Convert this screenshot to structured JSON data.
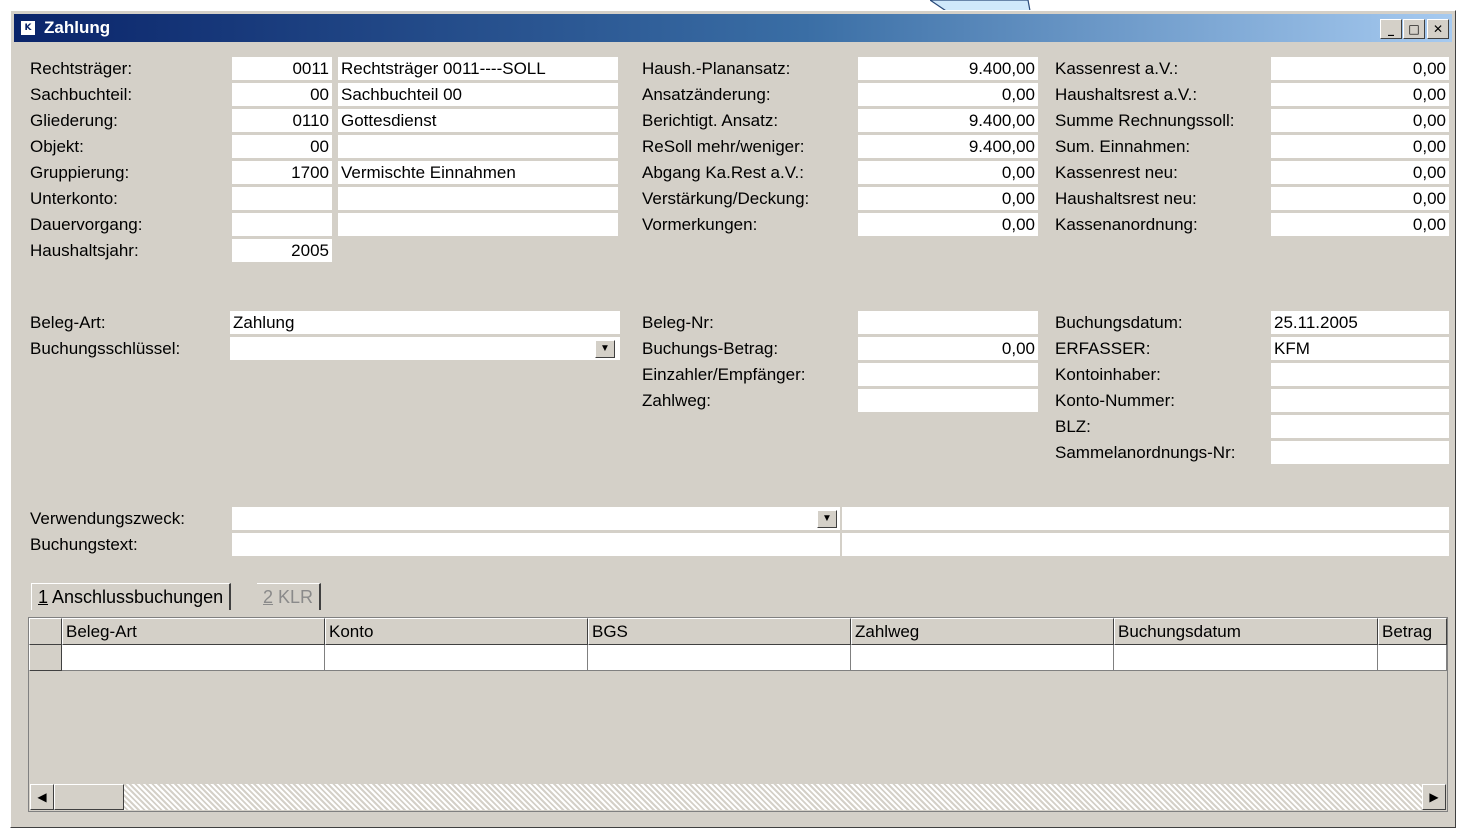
{
  "window": {
    "title": "Zahlung",
    "icon": "app-icon"
  },
  "left": [
    {
      "label": "Rechtsträger:",
      "code": "0011",
      "text": "Rechtsträger 0011----SOLL"
    },
    {
      "label": "Sachbuchteil:",
      "code": "00",
      "text": "Sachbuchteil 00"
    },
    {
      "label": "Gliederung:",
      "code": "0110",
      "text": "Gottesdienst"
    },
    {
      "label": "Objekt:",
      "code": "00",
      "text": ""
    },
    {
      "label": "Gruppierung:",
      "code": "1700",
      "text": "Vermischte Einnahmen"
    },
    {
      "label": "Unterkonto:",
      "code": "",
      "text": ""
    },
    {
      "label": "Dauervorgang:",
      "code": "",
      "text": ""
    },
    {
      "label": "Haushaltsjahr:",
      "code": "2005"
    }
  ],
  "mid": [
    {
      "label": "Haush.-Planansatz:",
      "value": "9.400,00"
    },
    {
      "label": "Ansatzänderung:",
      "value": "0,00"
    },
    {
      "label": "Berichtigt. Ansatz:",
      "value": "9.400,00"
    },
    {
      "label": "ReSoll mehr/weniger:",
      "value": "9.400,00"
    },
    {
      "label": "Abgang Ka.Rest a.V.:",
      "value": "0,00"
    },
    {
      "label": "Verstärkung/Deckung:",
      "value": "0,00"
    },
    {
      "label": "Vormerkungen:",
      "value": "0,00"
    }
  ],
  "right": [
    {
      "label": "Kassenrest a.V.:",
      "value": "0,00"
    },
    {
      "label": "Haushaltsrest a.V.:",
      "value": "0,00"
    },
    {
      "label": "Summe Rechnungssoll:",
      "value": "0,00"
    },
    {
      "label": "Sum. Einnahmen:",
      "value": "0,00"
    },
    {
      "label": "Kassenrest neu:",
      "value": "0,00"
    },
    {
      "label": "Haushaltsrest neu:",
      "value": "0,00"
    },
    {
      "label": "Kassenanordnung:",
      "value": "0,00"
    }
  ],
  "beleg": {
    "belegart_label": "Beleg-Art:",
    "belegart_value": "Zahlung",
    "schluessel_label": "Buchungsschlüssel:",
    "schluessel_value": "",
    "belegnr_label": "Beleg-Nr:",
    "belegnr_value": "",
    "betrag_label": "Buchungs-Betrag:",
    "betrag_value": "0,00",
    "einzahler_label": "Einzahler/Empfänger:",
    "einzahler_value": "",
    "zahlweg_label": "Zahlweg:",
    "zahlweg_value": "",
    "datum_label": "Buchungsdatum:",
    "datum_value": "25.11.2005",
    "erfasser_label": "ERFASSER:",
    "erfasser_value": "KFM",
    "inhaber_label": "Kontoinhaber:",
    "inhaber_value": "",
    "kontonr_label": "Konto-Nummer:",
    "kontonr_value": "",
    "blz_label": "BLZ:",
    "blz_value": "",
    "sammel_label": "Sammelanordnungs-Nr:",
    "sammel_value": ""
  },
  "zweck": {
    "label": "Verwendungszweck:",
    "value": "",
    "text_label": "Buchungstext:",
    "text_value": ""
  },
  "tabs": [
    {
      "mnemonic": "1",
      "label": " Anschlussbuchungen"
    },
    {
      "mnemonic": "2",
      "label": " KLR"
    }
  ],
  "table": {
    "columns": [
      "Beleg-Art",
      "Konto",
      "BGS",
      "Zahlweg",
      "Buchungsdatum",
      "Betrag"
    ]
  },
  "icons": {
    "dropdown": "chevron-down-icon",
    "scroll_left": "scroll-left-icon",
    "scroll_right": "scroll-right-icon"
  }
}
